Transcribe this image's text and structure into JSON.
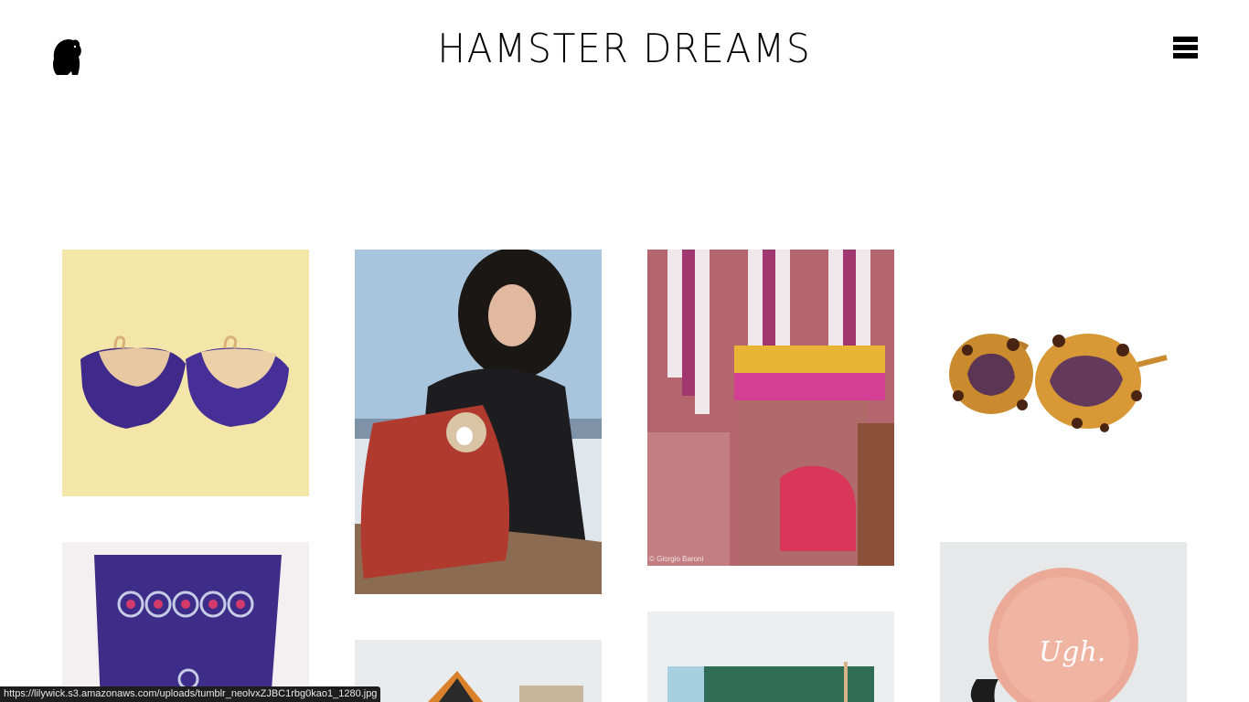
{
  "header": {
    "title": "HAMSTER DREAMS",
    "logo_icon": "hamster-silhouette-icon",
    "menu_icon": "hamburger-menu-icon"
  },
  "grid": {
    "items": [
      {
        "subject": "purple fringe fan earrings"
      },
      {
        "subject": "woman in fur hood with dog in red leather bag"
      },
      {
        "subject": "pink striped canopy bed room",
        "credit": "© Giorgio Baroni"
      },
      {
        "subject": "tortoiseshell sunglasses with purple lenses"
      },
      {
        "subject": "purple embroidered textile"
      },
      {
        "subject": "house rooftop in snow"
      },
      {
        "subject": "green and blue notebooks"
      },
      {
        "subject": "pink yo-yo",
        "text": "Ugh."
      }
    ]
  },
  "status_bar": {
    "url": "https://lilywick.s3.amazonaws.com/uploads/tumblr_neolvxZJBC1rbg0kao1_1280.jpg"
  },
  "colors": {
    "background": "#ffffff",
    "text": "#000000",
    "status_bg": "#1e1e1e"
  }
}
